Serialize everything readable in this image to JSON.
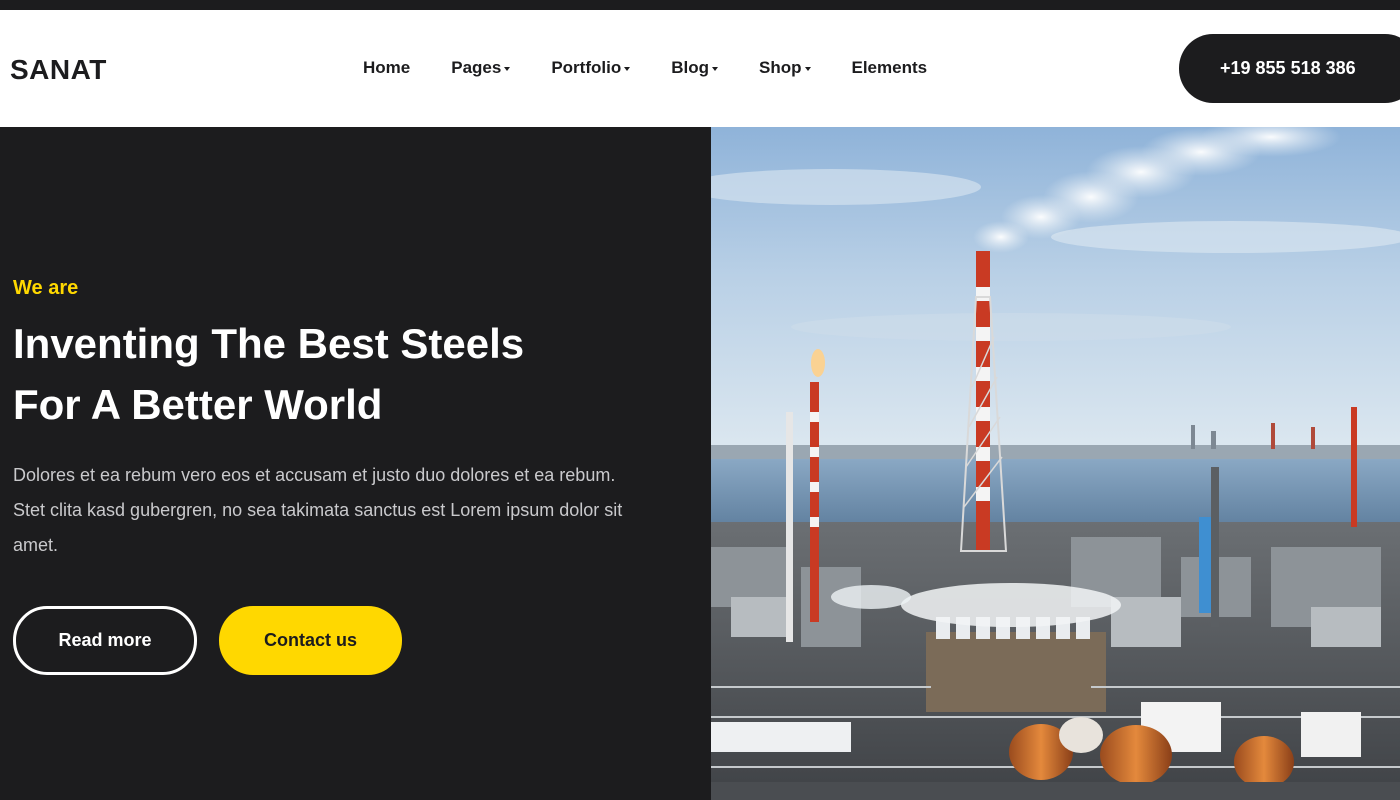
{
  "brand": {
    "logo_text": "SANAT"
  },
  "nav": {
    "items": [
      {
        "label": "Home",
        "has_dropdown": false
      },
      {
        "label": "Pages",
        "has_dropdown": true
      },
      {
        "label": "Portfolio",
        "has_dropdown": true
      },
      {
        "label": "Blog",
        "has_dropdown": true
      },
      {
        "label": "Shop",
        "has_dropdown": true
      },
      {
        "label": "Elements",
        "has_dropdown": false
      }
    ]
  },
  "header": {
    "phone_label": "+19 855 518 386"
  },
  "hero": {
    "eyebrow": "We are",
    "headline_line1": "Inventing The Best Steels",
    "headline_line2": "For A Better World",
    "body": "Dolores et ea rebum vero eos et accusam et justo duo dolores et ea rebum. Stet clita kasd gubergren, no sea takimata sanctus est Lorem ipsum dolor sit amet.",
    "read_more_label": "Read more",
    "contact_label": "Contact us",
    "image_icon": "industrial-refinery-photo"
  },
  "colors": {
    "dark": "#1c1c1e",
    "accent_yellow": "#ffd800",
    "white": "#ffffff",
    "body_text": "#c9c9cc"
  }
}
